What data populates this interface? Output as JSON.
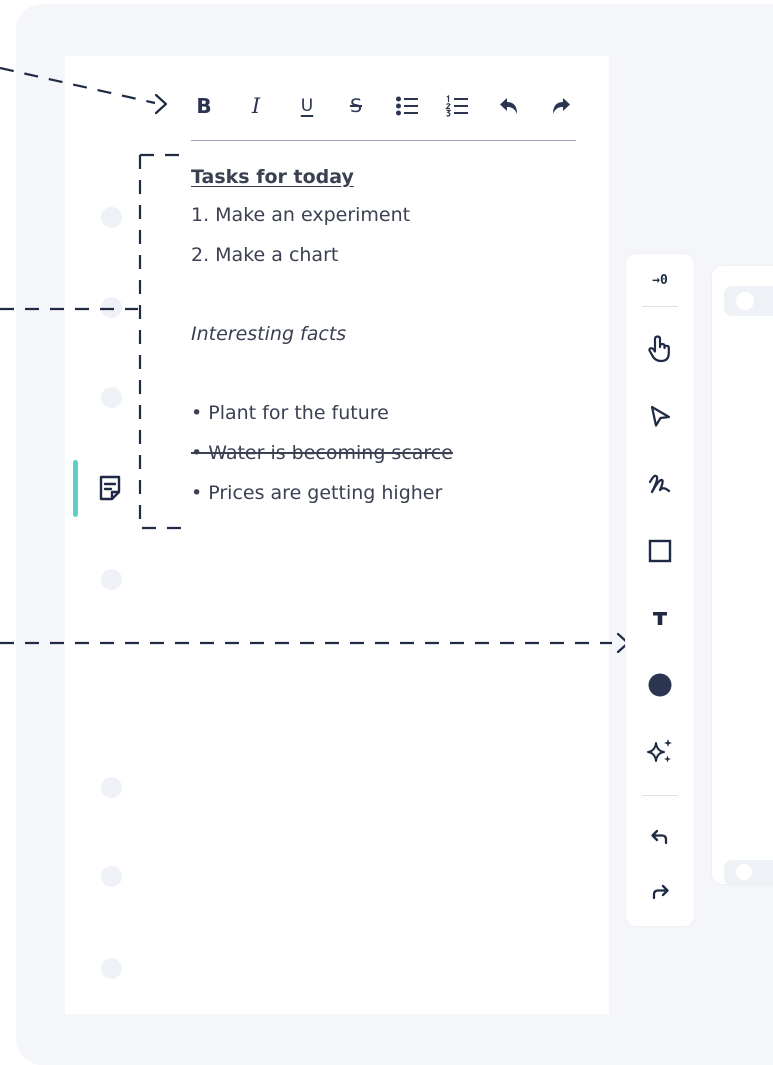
{
  "toolbar": {
    "bold_label": "B",
    "italic_label": "I",
    "underline_label": "U",
    "strikethrough_label": "S",
    "icons": [
      "bulleted-list-icon",
      "numbered-list-icon",
      "undo-icon",
      "redo-icon"
    ]
  },
  "note": {
    "heading": "Tasks for today",
    "tasks": [
      "1.  Make an experiment",
      "2.  Make a chart"
    ],
    "subheading": "Interesting facts",
    "facts": [
      {
        "text": "• Plant for the future",
        "strikethrough": false
      },
      {
        "text": "• Water is becoming scarce",
        "strikethrough": true
      },
      {
        "text": "• Prices are getting higher",
        "strikethrough": false
      }
    ]
  },
  "sidebar": {
    "collapse_label": "→0",
    "tools": [
      "hand-icon",
      "pointer-icon",
      "pen-icon",
      "rectangle-icon",
      "text-icon",
      "circle-icon",
      "sparkle-icon",
      "undo-icon",
      "redo-icon"
    ]
  },
  "colors": {
    "accent": "#5dd0c6",
    "ink": "#1f2a44",
    "text": "#3b4052",
    "background": "#f4f6fa",
    "rail_dot": "#eef1f6"
  }
}
